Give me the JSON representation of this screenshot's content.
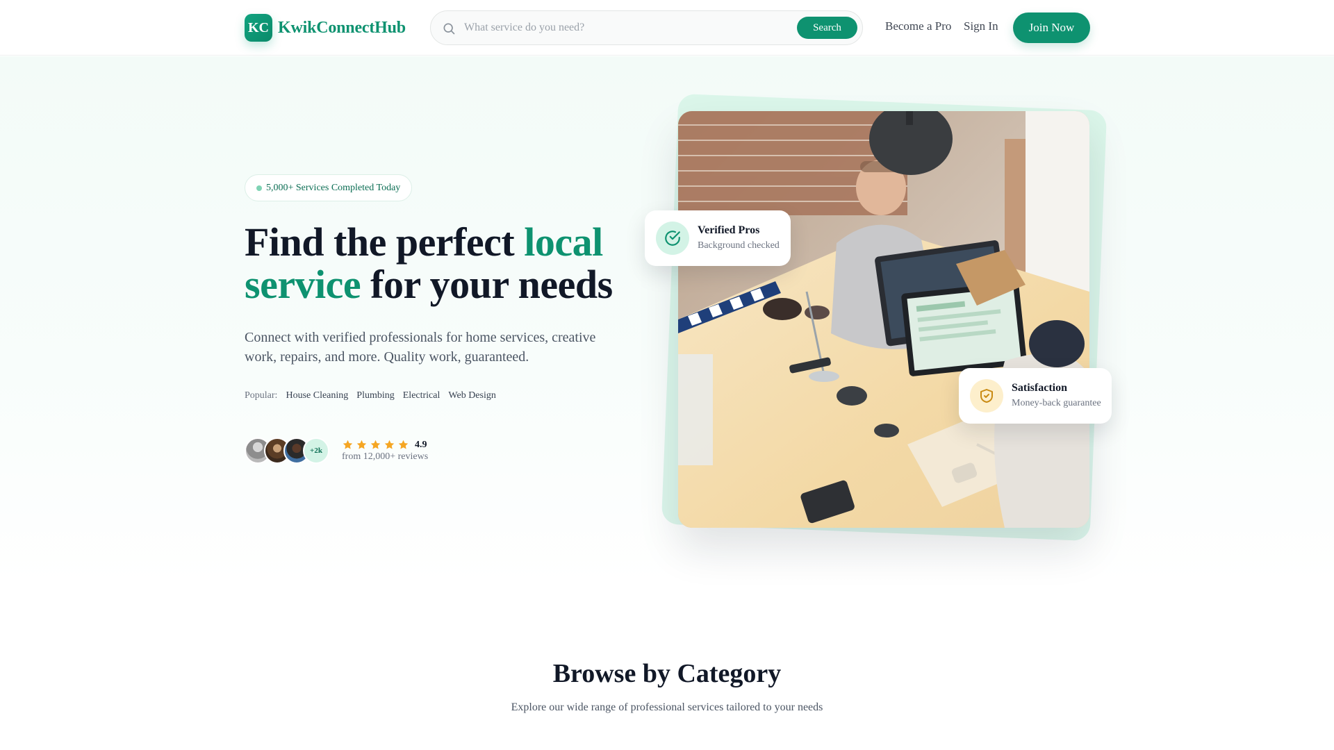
{
  "brand": {
    "mark": "KC",
    "name": "KwikConnectHub"
  },
  "search": {
    "placeholder": "What service do you need?",
    "value": "",
    "button_label": "Search"
  },
  "nav": {
    "become_pro": "Become a Pro",
    "sign_in": "Sign In",
    "join_now": "Join Now"
  },
  "hero": {
    "badge": "5,000+ Services Completed Today",
    "headline_part1": "Find the perfect ",
    "headline_accent": "local service",
    "headline_part2": " for your needs",
    "subtext": "Connect with verified professionals for home services, creative work, repairs, and more. Quality work, guaranteed.",
    "popular_label": "Popular:",
    "popular_tags": [
      "House Cleaning",
      "Plumbing",
      "Electrical",
      "Web Design"
    ],
    "avatar_more": "+2k",
    "rating_stars": 5,
    "rating": "4.9",
    "reviews": "from 12,000+ reviews"
  },
  "cards": {
    "verified": {
      "title": "Verified Pros",
      "subtitle": "Background checked",
      "icon": "check-circle-icon"
    },
    "satisfaction": {
      "title": "Satisfaction",
      "subtitle": "Money-back guarantee",
      "icon": "shield-check-icon"
    }
  },
  "categories": {
    "title": "Browse by Category",
    "subtitle": "Explore our wide range of professional services tailored to your needs"
  },
  "colors": {
    "brand": "#0e9270",
    "star": "#f5a623",
    "heading": "#111827"
  }
}
